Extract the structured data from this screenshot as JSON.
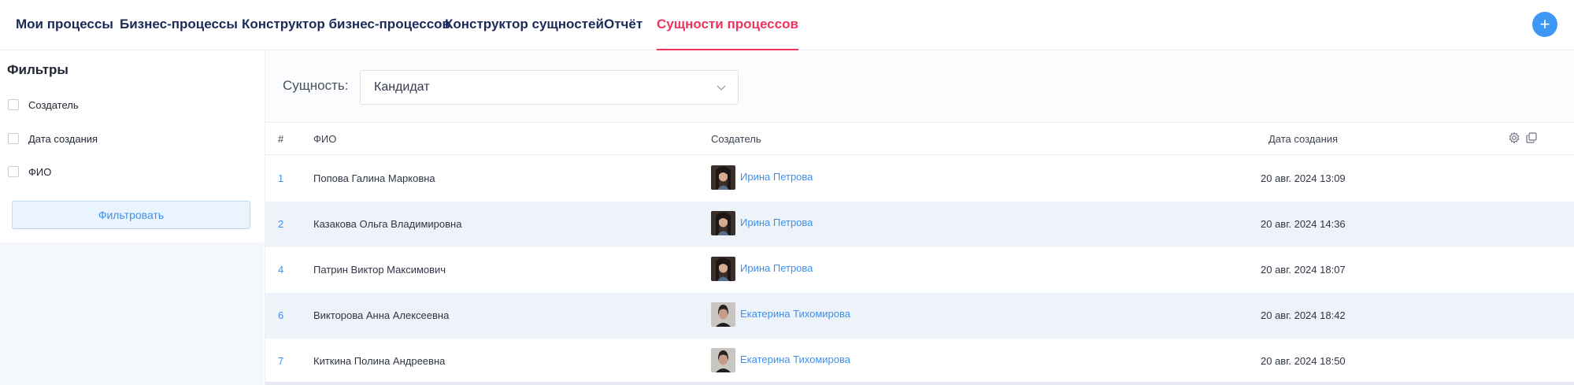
{
  "nav": {
    "items": [
      {
        "label": "Мои процессы",
        "active": false
      },
      {
        "label": "Бизнес-процессы",
        "active": false
      },
      {
        "label": "Конструктор бизнес-процессов",
        "active": false
      },
      {
        "label": "Конструктор сущностей",
        "active": false
      },
      {
        "label": "Отчёт",
        "active": false
      },
      {
        "label": "Сущности процессов",
        "active": true
      }
    ],
    "add_icon": "plus-icon",
    "add_label": "+"
  },
  "filters": {
    "title": "Фильтры",
    "items": [
      {
        "label": "Создатель",
        "checked": false
      },
      {
        "label": "Дата создания",
        "checked": false
      },
      {
        "label": "ФИО",
        "checked": false
      }
    ],
    "button_label": "Фильтровать"
  },
  "entity": {
    "label": "Сущность:",
    "value": "Кандидат"
  },
  "table": {
    "columns": {
      "num": "#",
      "fio": "ФИО",
      "creator": "Создатель",
      "date": "Дата создания"
    },
    "header_icons": [
      "gear-icon",
      "copy-icon"
    ],
    "rows": [
      {
        "num": "1",
        "fio": "Попова Галина Марковна",
        "creator": "Ирина Петрова",
        "date": "20 авг. 2024 13:09"
      },
      {
        "num": "2",
        "fio": "Казакова Ольга Владимировна",
        "creator": "Ирина Петрова",
        "date": "20 авг. 2024 14:36"
      },
      {
        "num": "4",
        "fio": "Патрин Виктор Максимович",
        "creator": "Ирина Петрова",
        "date": "20 авг. 2024 18:07"
      },
      {
        "num": "6",
        "fio": "Викторова Анна Алексеевна",
        "creator": "Екатерина Тихомирова",
        "date": "20 авг. 2024 18:42"
      },
      {
        "num": "7",
        "fio": "Киткина Полина Андреевна",
        "creator": "Екатерина Тихомирова",
        "date": "20 авг. 2024 18:50"
      }
    ]
  },
  "colors": {
    "accent": "#3f97f5",
    "active_tab": "#f0325f",
    "nav_text": "#1b2a57",
    "link": "#3f8fea"
  }
}
